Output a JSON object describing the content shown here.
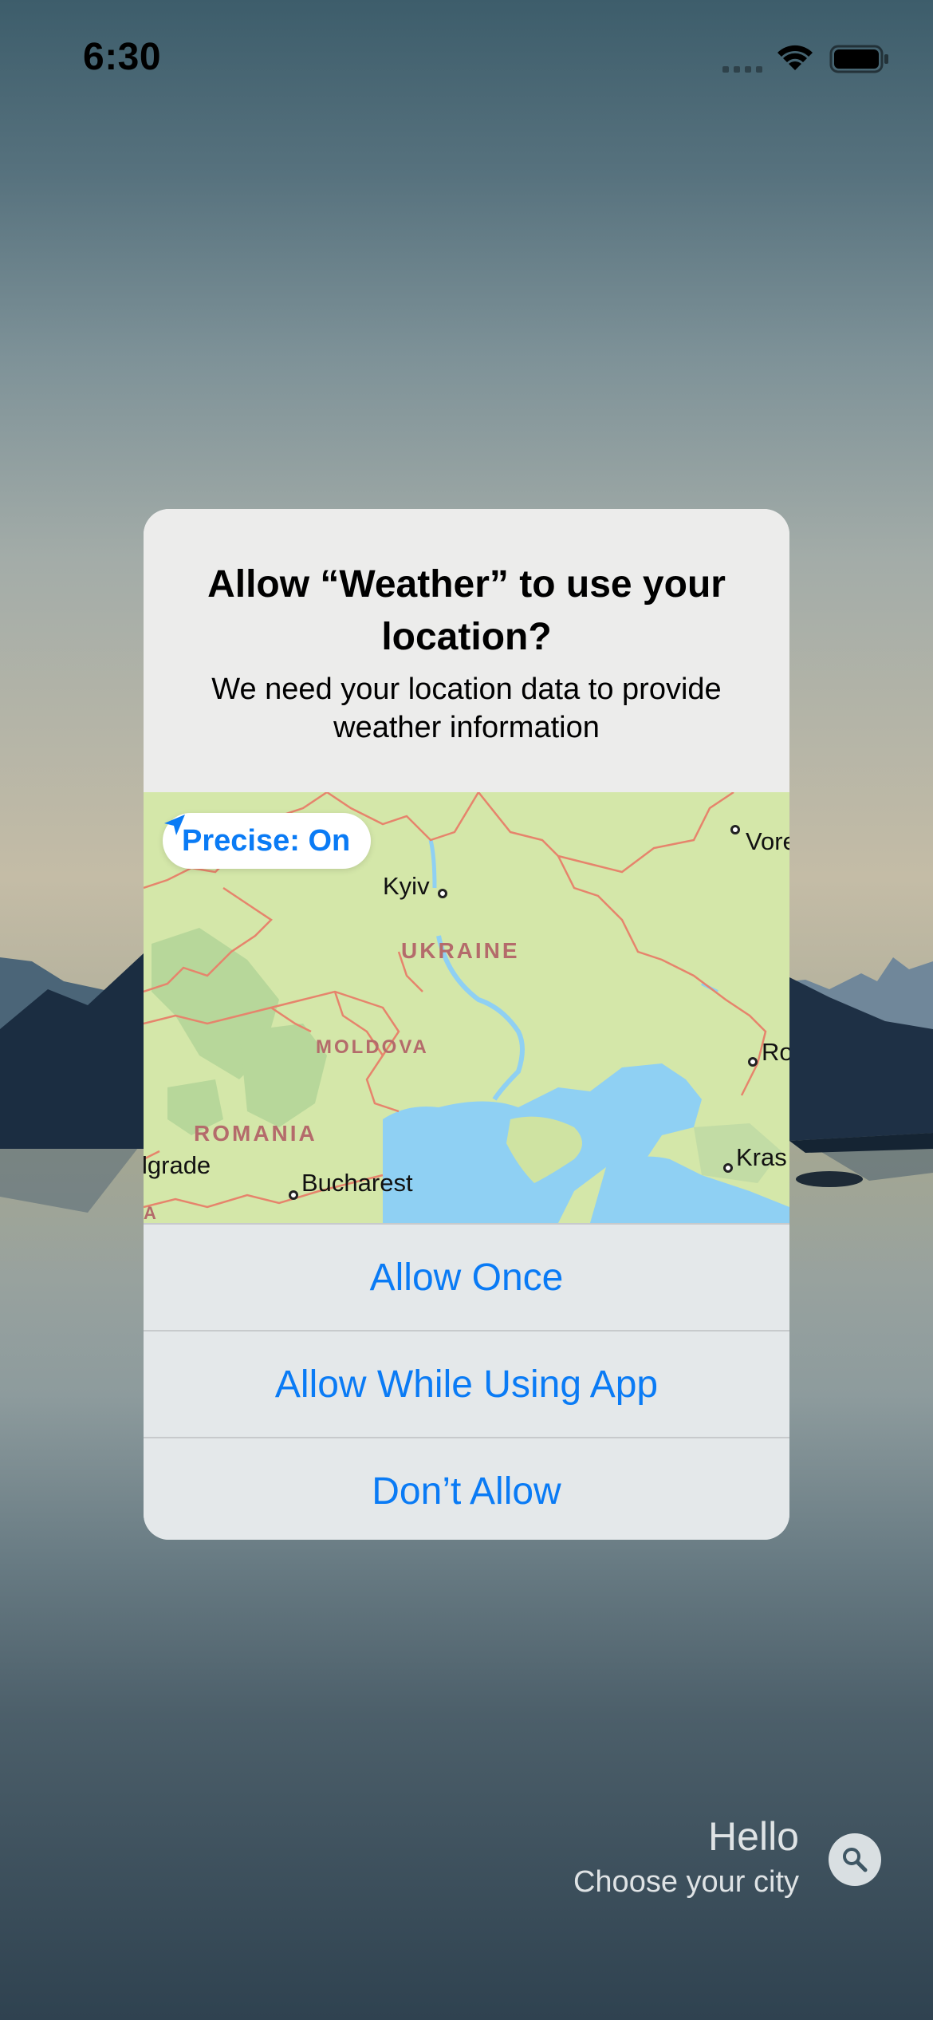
{
  "status_bar": {
    "time": "6:30"
  },
  "alert": {
    "title": "Allow “Weather” to use your location?",
    "message": "We need your location data to provide weather information",
    "precise_label": "Precise: On",
    "buttons": [
      "Allow Once",
      "Allow While Using App",
      "Don’t Allow"
    ],
    "map": {
      "cities": [
        "Kyiv",
        "Bucharest",
        "lgrade",
        "Vore",
        "Ro",
        "Kras"
      ],
      "countries": [
        "UKRAINE",
        "MOLDOVA",
        "ROMANIA",
        "A"
      ]
    }
  },
  "home": {
    "greeting": "Hello",
    "subtitle": "Choose your city"
  },
  "icons": [
    "location-arrow-icon",
    "search-icon",
    "wifi-icon",
    "battery-icon",
    "signal-icon"
  ],
  "colors": {
    "accent": "#0a7bf5",
    "alert_bg": "#ececeb",
    "map_land": "#d4e7a9",
    "map_water": "#8fd0f3",
    "border": "#e6846c"
  }
}
